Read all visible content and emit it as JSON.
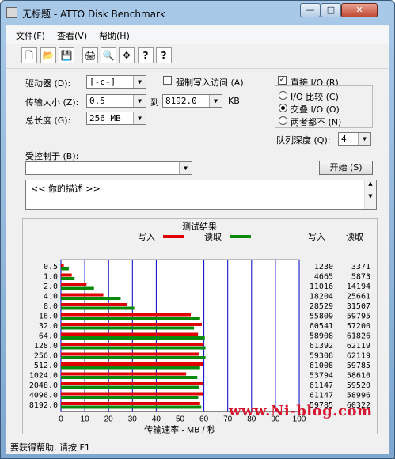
{
  "window": {
    "title": "无标题 - ATTO Disk Benchmark",
    "controls": {
      "min": "—",
      "max": "□",
      "close": "✕"
    }
  },
  "menu": [
    "文件(F)",
    "查看(V)",
    "帮助(H)"
  ],
  "toolbar": {
    "icons": [
      "new-icon",
      "open-icon",
      "save-icon",
      "print-icon",
      "print-preview-icon",
      "move-icon",
      "help-icon",
      "context-help-icon"
    ],
    "glyphs": [
      "🗋",
      "📂",
      "💾",
      "🖨",
      "🔍",
      "✥",
      "?",
      "?"
    ]
  },
  "form": {
    "drive_label": "驱动器 (D):",
    "drive_value": "[-c-]",
    "force_write_label": "强制写入访问 (A)",
    "direct_io_label": "直接 I/O (R)",
    "transfer_size_label": "传输大小 (Z):",
    "transfer_from": "0.5",
    "to_label": "到",
    "transfer_to": "8192.0",
    "unit_kb": "KB",
    "io_compare_label": "I/O 比较 (C)",
    "overlapped_io_label": "交叠 I/O (O)",
    "neither_label": "两者都不 (N)",
    "total_length_label": "总长度 (G):",
    "total_length_value": "256 MB",
    "queue_depth_label": "队列深度 (Q):",
    "queue_depth_value": "4",
    "controlled_by_label": "受控制于 (B):",
    "controlled_by_value": "",
    "start_button": "开始 (S)",
    "description": "<<  你的描述  >>"
  },
  "results": {
    "title": "测试结果",
    "legend_write": "写入",
    "legend_read": "读取",
    "col_write": "写入",
    "col_read": "读取",
    "write_color": "#e00000",
    "read_color": "#0a8a0a",
    "grid_color": "#0000c8",
    "xlabel": "传输速率 - MB / 秒"
  },
  "chart_data": {
    "type": "bar",
    "title": "测试结果",
    "categories": [
      "0.5",
      "1.0",
      "2.0",
      "4.0",
      "8.0",
      "16.0",
      "32.0",
      "64.0",
      "128.0",
      "256.0",
      "512.0",
      "1024.0",
      "2048.0",
      "4096.0",
      "8192.0"
    ],
    "series": [
      {
        "name": "写入",
        "values": [
          1230,
          4665,
          11016,
          18204,
          28529,
          55809,
          60541,
          58908,
          61392,
          59308,
          61008,
          53794,
          61147,
          61147,
          59785
        ]
      },
      {
        "name": "读取",
        "values": [
          3371,
          5873,
          14194,
          25661,
          31507,
          59795,
          57200,
          61826,
          62119,
          62119,
          59785,
          58610,
          59520,
          58996,
          60322
        ]
      }
    ],
    "xticks": [
      "0",
      "10",
      "20",
      "30",
      "40",
      "50",
      "60",
      "70",
      "80",
      "90",
      "100"
    ],
    "xlim": [
      0,
      100
    ],
    "xlabel": "传输速率 - MB / 秒",
    "ylabel": "",
    "grid": true,
    "legend": "top-center"
  },
  "status": {
    "text": "要获得帮助, 请按 F1"
  },
  "watermark": "www.Ni-blog.com"
}
